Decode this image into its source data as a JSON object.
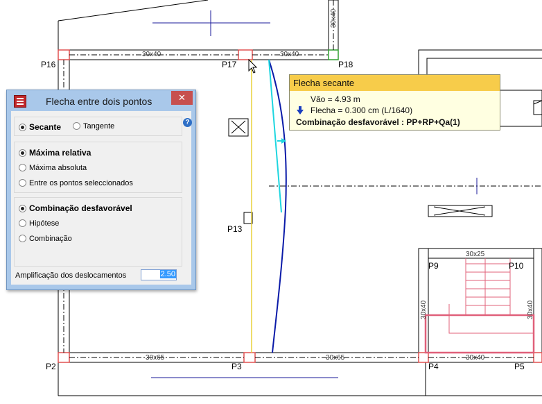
{
  "plan": {
    "pillars": [
      "P16",
      "P17",
      "P18",
      "P13",
      "P9",
      "P10",
      "P2",
      "P3",
      "P4",
      "P5"
    ],
    "beams": [
      "30x40",
      "30x40",
      "30x40",
      "30x25",
      "30x40",
      "30x40",
      "30x65",
      "30x65",
      "30x40"
    ],
    "colors": {
      "wall": "#000000",
      "deflection_curve": "#0a1aa8",
      "secant": "#1ed6e0",
      "support_line": "#e8d23a",
      "stair": "#e0607a",
      "axis": "#1a1a9a"
    }
  },
  "dialog": {
    "title": "Flecha entre dois pontos",
    "close_label": "✕",
    "help_label": "?",
    "mode_group": {
      "secante": "Secante",
      "tangente": "Tangente",
      "selected": "Secante"
    },
    "type_group": {
      "maxima_relativa": "Máxima relativa",
      "maxima_absoluta": "Máxima absoluta",
      "entre_pontos": "Entre os pontos seleccionados",
      "selected": "Máxima relativa"
    },
    "combo_group": {
      "desfavoravel": "Combinação desfavorável",
      "hipotese": "Hipótese",
      "combinacao": "Combinação",
      "selected": "Combinação desfavorável"
    },
    "amplification_label": "Amplificação dos deslocamentos",
    "amplification_value": "2.50"
  },
  "tooltip": {
    "title": "Flecha secante",
    "span": "Vão = 4.93 m",
    "deflection": "Flecha = 0.300 cm (L/1640)",
    "combination": "Combinação desfavorável : PP+RP+Qa(1)"
  }
}
